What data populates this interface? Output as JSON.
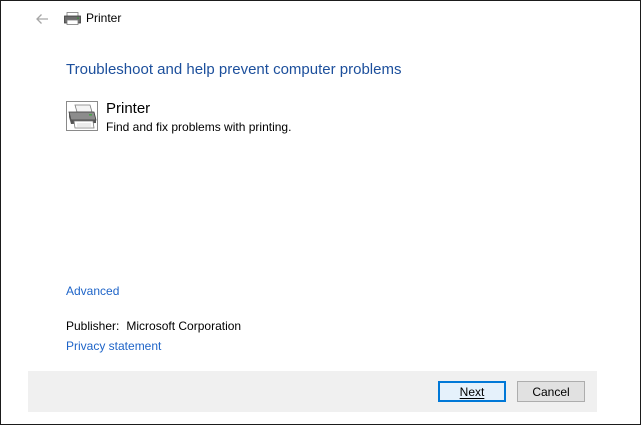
{
  "window": {
    "title": "Printer",
    "title_icon": "printer-icon",
    "back_icon": "back-arrow-icon"
  },
  "content": {
    "heading": "Troubleshoot and help prevent computer problems",
    "item": {
      "icon": "printer-icon",
      "title": "Printer",
      "description": "Find and fix problems with printing."
    },
    "advanced_link": "Advanced",
    "publisher_label": "Publisher:",
    "publisher_name": "Microsoft Corporation",
    "privacy_link": "Privacy statement"
  },
  "footer": {
    "next_label": "Next",
    "cancel_label": "Cancel"
  },
  "colors": {
    "heading": "#1c4f9c",
    "link": "#1e64c8",
    "default_button_border": "#0078d7"
  }
}
